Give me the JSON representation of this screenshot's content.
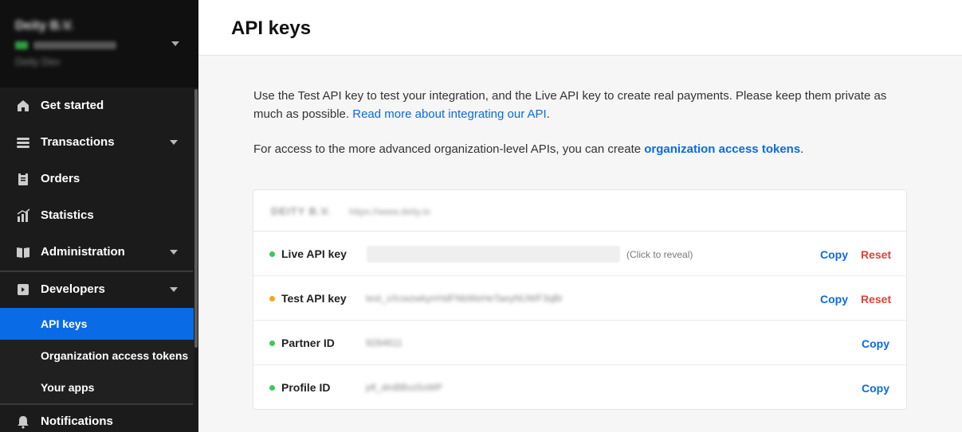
{
  "sidebar": {
    "org_name": "Deity B.V.",
    "org_status": "Blurred status",
    "org_id": "Blurred id",
    "org_sub": "Deity Dev",
    "items": [
      {
        "label": "Get started",
        "icon": "home-icon"
      },
      {
        "label": "Transactions",
        "icon": "transactions-icon"
      },
      {
        "label": "Orders",
        "icon": "orders-icon"
      },
      {
        "label": "Statistics",
        "icon": "statistics-icon"
      },
      {
        "label": "Administration",
        "icon": "administration-icon"
      },
      {
        "label": "Developers",
        "icon": "developers-icon"
      },
      {
        "label": "Notifications",
        "icon": "bell-icon"
      }
    ],
    "sub_items": [
      {
        "label": "API keys"
      },
      {
        "label": "Organization access tokens"
      },
      {
        "label": "Your apps"
      }
    ]
  },
  "header": {
    "title": "API keys"
  },
  "intro": {
    "text1": "Use the Test API key to test your integration, and the Live API key to create real payments. Please keep them private as much as possible. ",
    "link1": "Read more about integrating our API",
    "text1_end": ".",
    "text2": "For access to the more advanced organization-level APIs, you can create ",
    "link2": "organization access tokens",
    "text2_end": "."
  },
  "card": {
    "org_name": "DEITY B.V.",
    "org_url": "https://www.deity.io",
    "rows": [
      {
        "label": "Live API key",
        "value": "",
        "reveal": "(Click to reveal)",
        "copy": "Copy",
        "reset": "Reset",
        "status_color": "#3cc95a"
      },
      {
        "label": "Test API key",
        "value": "test_xXcwzwkyrrHdFNbWeHeTaeyNUWF3qBr",
        "copy": "Copy",
        "reset": "Reset",
        "status_color": "#f5a623"
      },
      {
        "label": "Partner ID",
        "value": "9284611",
        "copy": "Copy",
        "status_color": "#3cc95a"
      },
      {
        "label": "Profile ID",
        "value": "pfl_dmBBvz5sWP",
        "copy": "Copy",
        "status_color": "#3cc95a"
      }
    ]
  },
  "colors": {
    "accent": "#0a6be6",
    "danger": "#e0413a",
    "live": "#3cc95a",
    "test": "#f5a623"
  }
}
